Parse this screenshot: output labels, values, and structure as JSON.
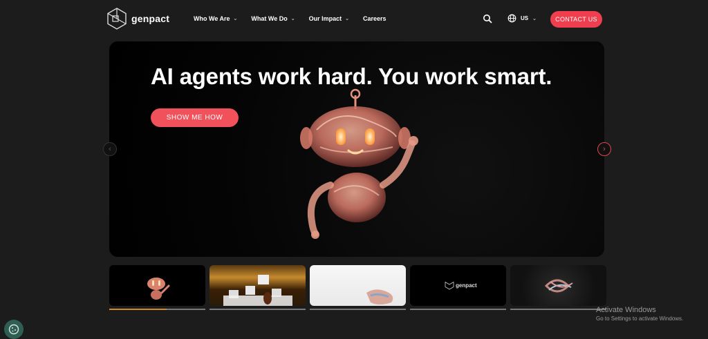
{
  "header": {
    "logo_text": "genpact",
    "nav": [
      {
        "label": "Who We Are",
        "has_dropdown": true
      },
      {
        "label": "What We Do",
        "has_dropdown": true
      },
      {
        "label": "Our Impact",
        "has_dropdown": true
      },
      {
        "label": "Careers",
        "has_dropdown": false
      }
    ],
    "region_label": "US",
    "contact_label": "CONTACT US"
  },
  "hero": {
    "headline": "AI agents work hard. You work smart.",
    "cta_label": "SHOW ME HOW"
  },
  "carousel": {
    "thumbnails": [
      {
        "name": "robot-slide"
      },
      {
        "name": "orchestra-slide"
      },
      {
        "name": "ribbon-slide"
      },
      {
        "name": "genpact-logo-slide",
        "text": "genpact"
      },
      {
        "name": "knot-slide"
      }
    ],
    "active_progress": 0.6
  },
  "watermark": {
    "title": "Activate Windows",
    "subtitle": "Go to Settings to activate Windows."
  },
  "colors": {
    "accent": "#ef3f4e",
    "progress": "#d08a2d",
    "background": "#1c1c1c"
  }
}
